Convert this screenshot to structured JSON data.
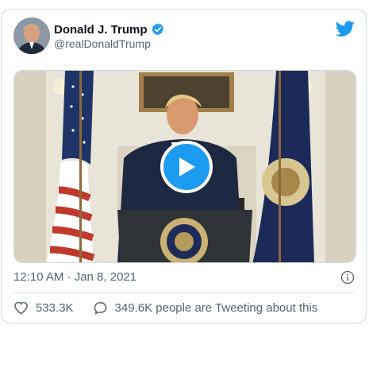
{
  "tweet": {
    "author_name": "Donald J. Trump",
    "author_handle": "@realDonaldTrump",
    "timestamp": "12:10 AM · Jan 8, 2021",
    "likes": "533.3K",
    "conversation": "349.6K people are Tweeting about this"
  },
  "icons": {
    "verified": "verified-badge-icon",
    "brand": "twitter-bird-icon",
    "play": "play-icon",
    "info": "info-icon",
    "like": "heart-icon",
    "reply": "speech-bubble-icon"
  },
  "colors": {
    "brand": "#1d9bf0",
    "text": "#0f1419",
    "secondary": "#536471",
    "border": "#cfd9de"
  }
}
